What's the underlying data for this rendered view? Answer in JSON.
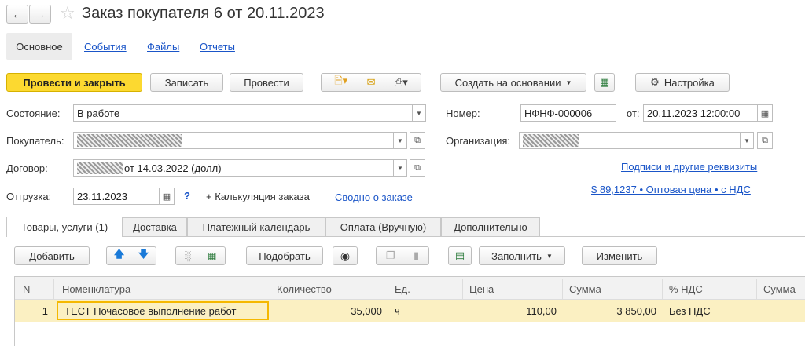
{
  "window": {
    "title": "Заказ покупателя 6 от 20.11.2023"
  },
  "nav": {
    "tabs": [
      "Основное",
      "События",
      "Файлы",
      "Отчеты"
    ]
  },
  "toolbar": {
    "post_close": "Провести и закрыть",
    "save": "Записать",
    "post": "Провести",
    "create_based": "Создать на основании",
    "settings": "Настройка"
  },
  "fields": {
    "state_label": "Состояние:",
    "state_value": "В работе",
    "number_label": "Номер:",
    "number_value": "НФНФ-000006",
    "date_label": "от:",
    "date_value": "20.11.2023 12:00:00",
    "buyer_label": "Покупатель:",
    "org_label": "Организация:",
    "contract_label": "Договор:",
    "contract_value": "от 14.03.2022 (долл)",
    "shipment_label": "Отгрузка:",
    "shipment_value": "23.11.2023",
    "help": "?",
    "calc": "+ Калькуляция заказа",
    "summary_link": "Сводно о заказе",
    "signatures_link": "Подписи и другие реквизиты",
    "price_link": "$ 89,1237 • Оптовая цена • с НДС"
  },
  "doc_tabs": [
    "Товары, услуги (1)",
    "Доставка",
    "Платежный календарь",
    "Оплата (Вручную)",
    "Дополнительно"
  ],
  "table_toolbar": {
    "add": "Добавить",
    "pick": "Подобрать",
    "fill": "Заполнить",
    "change": "Изменить"
  },
  "table": {
    "columns": [
      "N",
      "Номенклатура",
      "Количество",
      "Ед.",
      "Цена",
      "Сумма",
      "% НДС",
      "Сумма"
    ],
    "rows": [
      [
        "1",
        "ТЕСТ Почасовое выполнение работ",
        "35,000",
        "ч",
        "110,00",
        "3 850,00",
        "Без НДС",
        ""
      ]
    ]
  },
  "colors": {
    "accent": "#fcd930",
    "link": "#1a55c8",
    "row_highlight": "#fbf0c2"
  }
}
